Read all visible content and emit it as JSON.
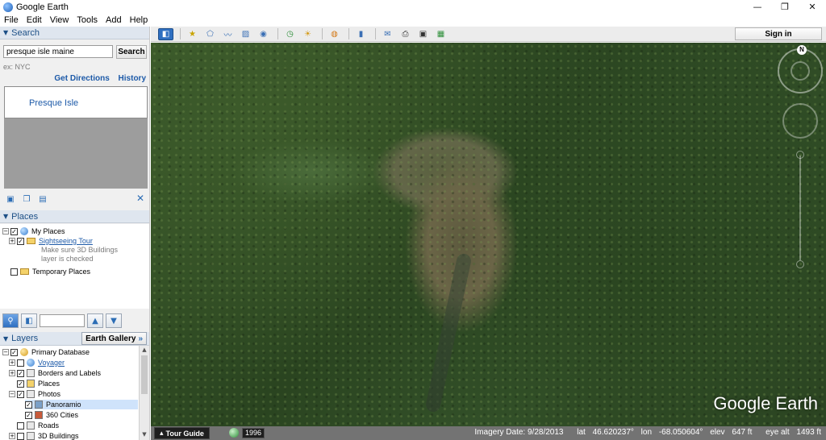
{
  "window": {
    "title": "Google Earth",
    "minimize": "—",
    "restore": "❐",
    "close": "✕"
  },
  "menu": [
    "File",
    "Edit",
    "View",
    "Tools",
    "Add",
    "Help"
  ],
  "search": {
    "header": "Search",
    "input_value": "presque isle maine",
    "button": "Search",
    "hint": "ex: NYC",
    "get_directions": "Get Directions",
    "history": "History",
    "result": "Presque Isle"
  },
  "places": {
    "header": "Places",
    "my_places": "My Places",
    "sightseeing": "Sightseeing Tour",
    "note_line1": "Make sure 3D Buildings",
    "note_line2": "layer is checked",
    "temporary": "Temporary Places"
  },
  "layers": {
    "header": "Layers",
    "earth_gallery": "Earth Gallery",
    "earth_gallery_arrow": "»",
    "items": [
      "Primary Database",
      "Voyager",
      "Borders and Labels",
      "Places",
      "Photos",
      "Panoramio",
      "360 Cities",
      "Roads",
      "3D Buildings"
    ]
  },
  "toolbar": {
    "sign_in": "Sign in"
  },
  "view": {
    "compass_n": "N",
    "logo": "Google Earth"
  },
  "status": {
    "tour_guide": "Tour Guide",
    "year": "1996",
    "imagery_date": "Imagery Date: 9/28/2013",
    "lat_label": "lat",
    "lat": "46.620237°",
    "lon_label": "lon",
    "lon": "-68.050604°",
    "elev_label": "elev",
    "elev": "647 ft",
    "eye_label": "eye alt",
    "eye_alt": "1493 ft"
  },
  "icons": {
    "app": "google-earth-icon",
    "tour": "tour-guide-icon"
  }
}
